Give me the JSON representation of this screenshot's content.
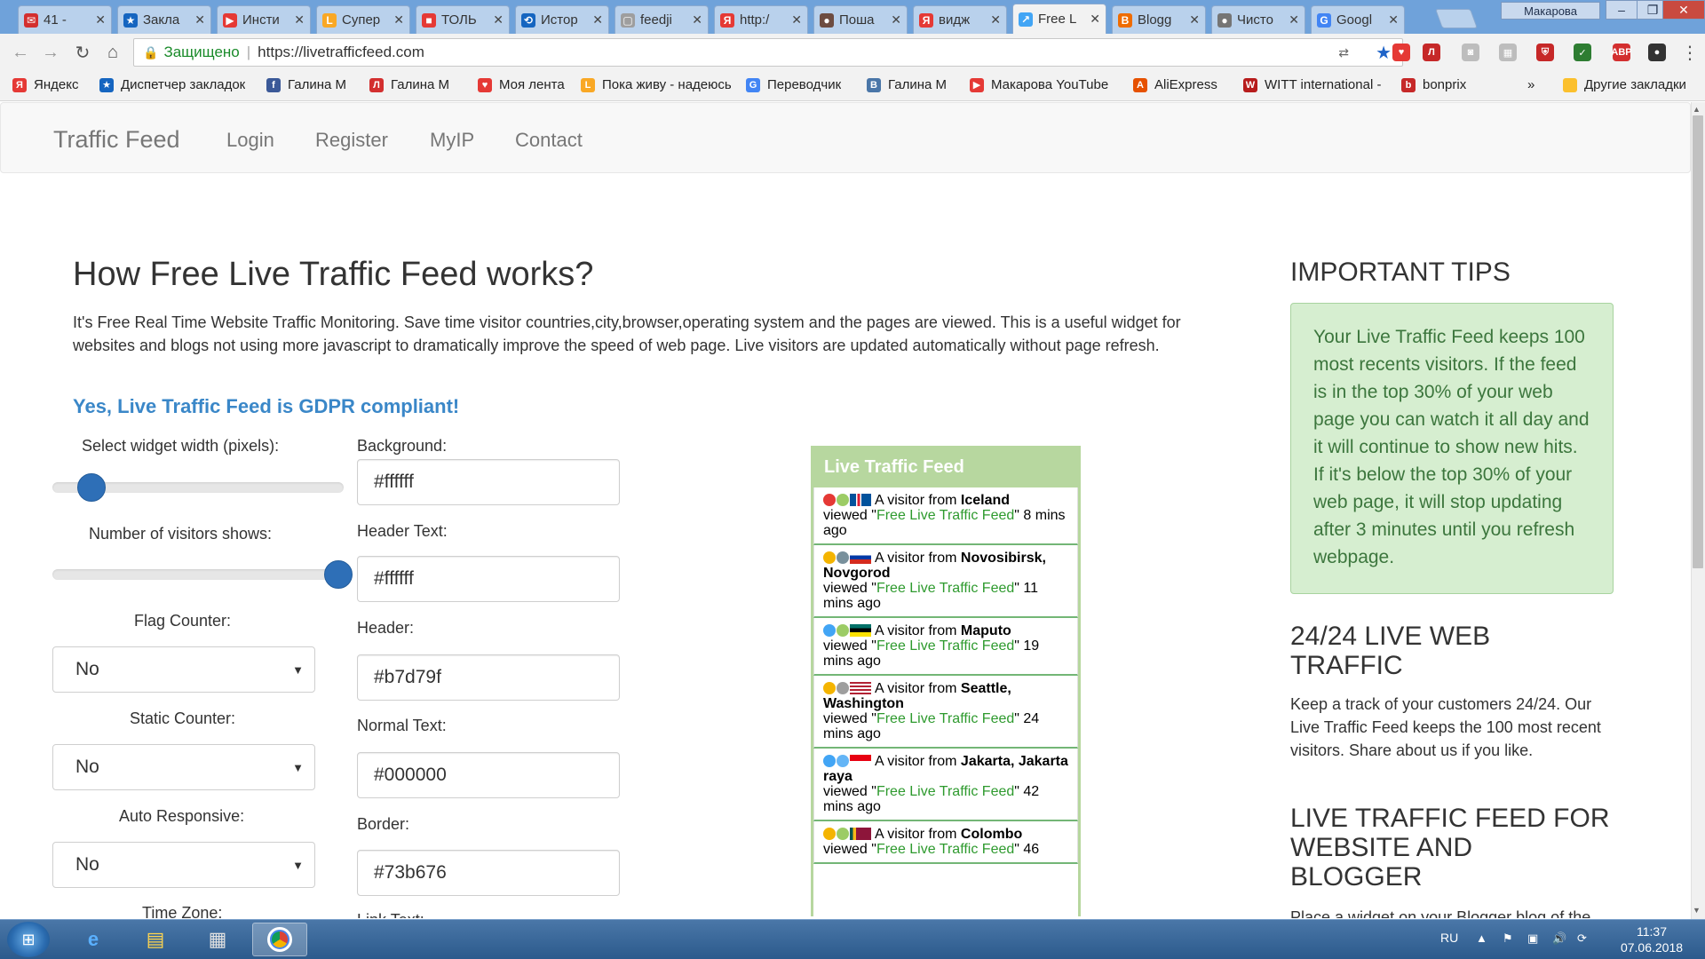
{
  "browser": {
    "tabs": [
      {
        "label": "41 -",
        "color": "#d32f2f",
        "glyph": "✉"
      },
      {
        "label": "Закла",
        "color": "#1565c0",
        "glyph": "★"
      },
      {
        "label": "Инсти",
        "color": "#e53935",
        "glyph": "▶"
      },
      {
        "label": "Супер",
        "color": "#f9a825",
        "glyph": "L"
      },
      {
        "label": "ТОЛЬ",
        "color": "#e53935",
        "glyph": "■"
      },
      {
        "label": "Истор",
        "color": "#1565c0",
        "glyph": "⟲"
      },
      {
        "label": "feedji",
        "color": "#9e9e9e",
        "glyph": "▢"
      },
      {
        "label": "http:/",
        "color": "#e53935",
        "glyph": "Я"
      },
      {
        "label": "Поша",
        "color": "#6d4c41",
        "glyph": "●"
      },
      {
        "label": "видж",
        "color": "#e53935",
        "glyph": "Я"
      },
      {
        "label": "Free L",
        "color": "#42a5f5",
        "glyph": "↗"
      },
      {
        "label": "Blogg",
        "color": "#ef6c00",
        "glyph": "B"
      },
      {
        "label": "Чисто",
        "color": "#757575",
        "glyph": "●"
      },
      {
        "label": "Googl",
        "color": "#4285f4",
        "glyph": "G"
      }
    ],
    "window_user": "Макарова",
    "secure_label": "Защищено",
    "url": "https://livetrafficfeed.com",
    "bookmarks": [
      {
        "label": "Яндекс",
        "color": "#e53935",
        "glyph": "Я"
      },
      {
        "label": "Диспетчер закладок",
        "color": "#1565c0",
        "glyph": "★"
      },
      {
        "label": "Галина М",
        "color": "#3b5998",
        "glyph": "f"
      },
      {
        "label": "Галина М",
        "color": "#d32f2f",
        "glyph": "Л"
      },
      {
        "label": "Моя лента",
        "color": "#e53935",
        "glyph": "♥"
      },
      {
        "label": "Пока живу - надеюсь",
        "color": "#f9a825",
        "glyph": "L"
      },
      {
        "label": "Переводчик",
        "color": "#4285f4",
        "glyph": "G"
      },
      {
        "label": "Галина М",
        "color": "#4a76a8",
        "glyph": "В"
      },
      {
        "label": "Макарова YouTube",
        "color": "#e53935",
        "glyph": "▶"
      },
      {
        "label": "AliExpress",
        "color": "#e65100",
        "glyph": "A"
      },
      {
        "label": "WITT international -",
        "color": "#b71c1c",
        "glyph": "W"
      },
      {
        "label": "bonprix",
        "color": "#c62828",
        "glyph": "b"
      }
    ],
    "more_bookmarks": "»",
    "other_bookmarks": "Другие закладки"
  },
  "site": {
    "brand": "Traffic Feed",
    "nav": [
      "Login",
      "Register",
      "MyIP",
      "Contact"
    ]
  },
  "main": {
    "title": "How Free Live Traffic Feed works?",
    "intro": "It's Free Real Time Website Traffic Monitoring. Save time visitor countries,city,browser,operating system and the pages are viewed. This is a useful widget for websites and blogs not using more javascript to dramatically improve the speed of web page. Live visitors are updated automatically without page refresh.",
    "gdpr": "Yes, Live Traffic Feed is GDPR compliant!",
    "controls": {
      "width_label": "Select widget width (pixels):",
      "width_value": 0.12,
      "visitors_label": "Number of visitors shows:",
      "visitors_value": 1.0,
      "flag_label": "Flag Counter:",
      "flag_value": "No",
      "static_label": "Static Counter:",
      "static_value": "No",
      "auto_label": "Auto Responsive:",
      "auto_value": "No",
      "timezone_label": "Time Zone:",
      "bg_label": "Background:",
      "bg_value": "#ffffff",
      "header_text_label": "Header Text:",
      "header_text_value": "#ffffff",
      "header_label": "Header:",
      "header_value": "#b7d79f",
      "normal_text_label": "Normal Text:",
      "normal_text_value": "#000000",
      "border_label": "Border:",
      "border_value": "#73b676",
      "link_text_label": "Link Text:"
    }
  },
  "widget": {
    "header": "Live Traffic Feed",
    "prefix": "A visitor from",
    "viewed": "viewed",
    "page": "Free Live Traffic Feed",
    "visits": [
      {
        "loc": "Iceland",
        "ago": "8 mins ago"
      },
      {
        "loc": "Novosibirsk, Novgorod",
        "ago": "11 mins ago"
      },
      {
        "loc": "Maputo",
        "ago": "19 mins ago"
      },
      {
        "loc": "Seattle, Washington",
        "ago": "24 mins ago"
      },
      {
        "loc": "Jakarta, Jakarta raya",
        "ago": "42 mins ago"
      },
      {
        "loc": "Colombo",
        "ago": "46"
      }
    ]
  },
  "sidebar": {
    "tips_title": "IMPORTANT TIPS",
    "tips_text": "Your Live Traffic Feed keeps 100 most recents visitors. If the feed is in the top 30% of your web page you can watch it all day and it will continue to show new hits. If it's below the top 30% of your web page, it will stop updating after 3 minutes until you refresh webpage.",
    "live_title": "24/24 LIVE WEB TRAFFIC",
    "live_text": "Keep a track of your customers 24/24. Our Live Traffic Feed keeps the 100 most recent visitors. Share about us if you like.",
    "feed_title": "LIVE TRAFFIC FEED FOR WEBSITE AND BLOGGER",
    "feed_text": "Place a widget on your Blogger blog of the"
  },
  "taskbar": {
    "lang": "RU",
    "time": "11:37",
    "date": "07.06.2018"
  }
}
